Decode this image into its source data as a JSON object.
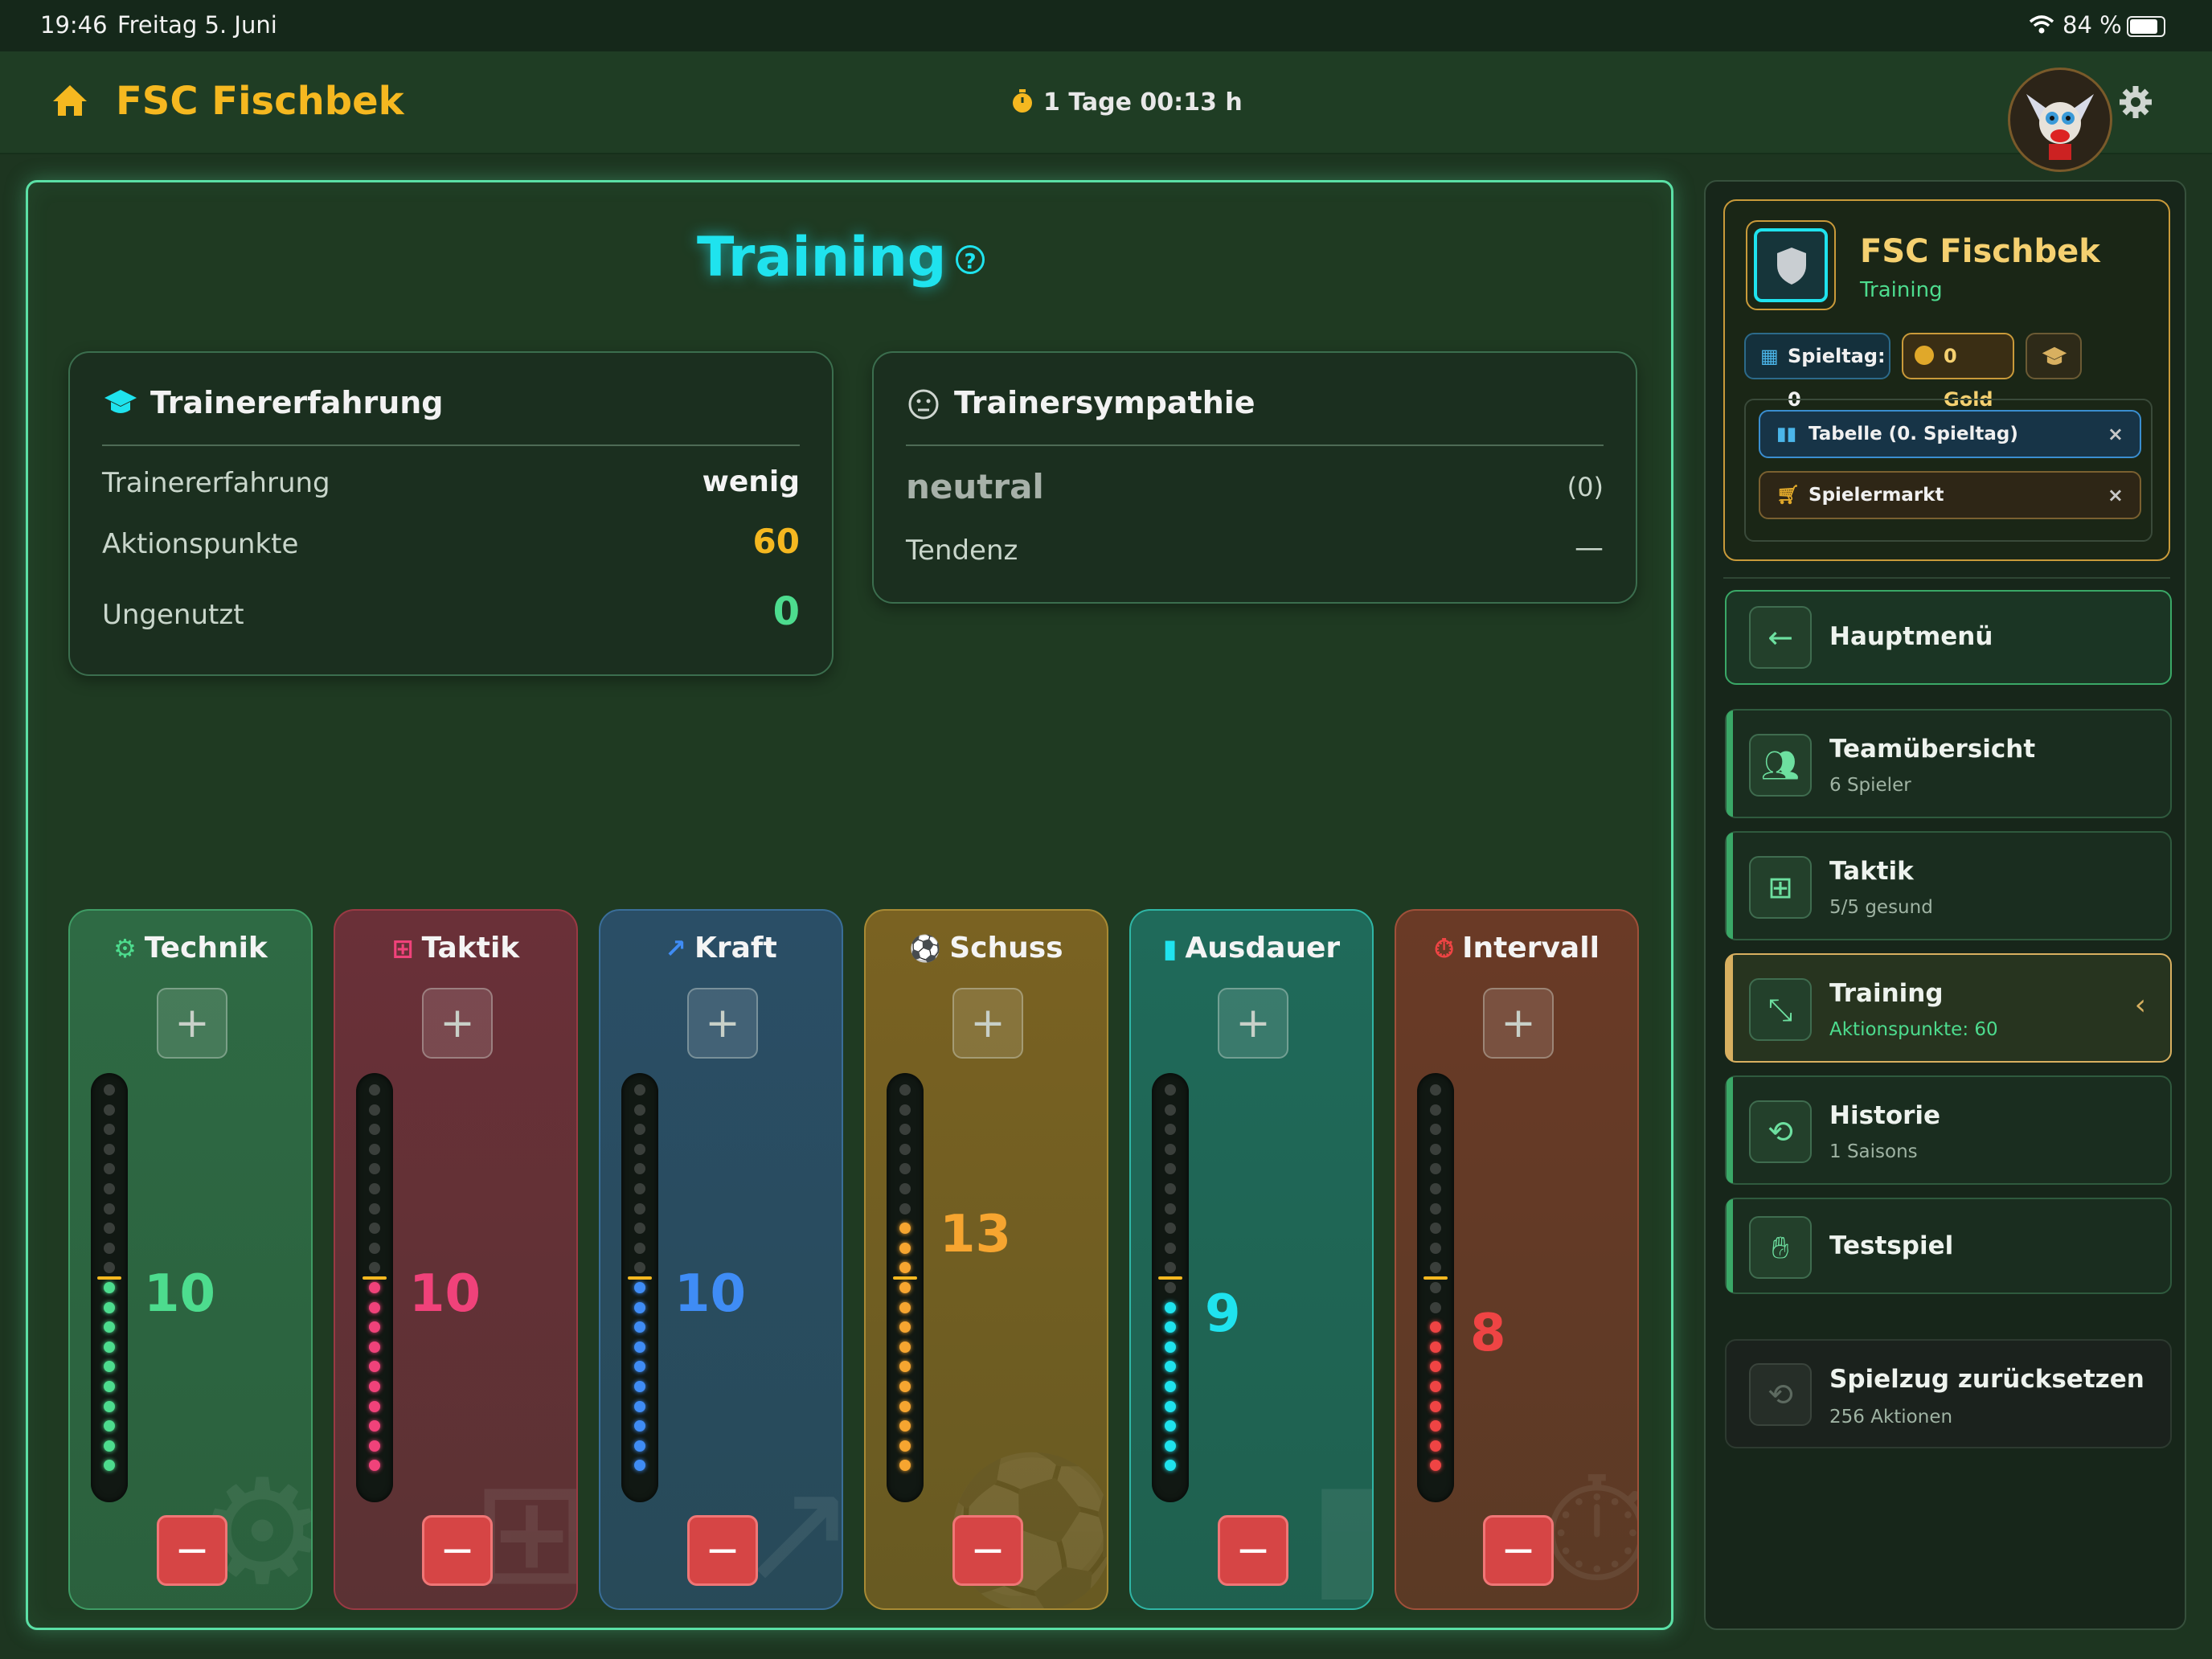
{
  "status_bar": {
    "time": "19:46",
    "date": "Freitag 5. Juni",
    "battery": "84 %"
  },
  "header": {
    "club_name": "FSC Fischbek",
    "timer": "1 Tage 00:13 h"
  },
  "page": {
    "title": "Training",
    "help_icon": "question-circle-icon"
  },
  "trainer_experience": {
    "heading": "Trainererfahrung",
    "rows": [
      {
        "label": "Trainererfahrung",
        "value": "wenig"
      },
      {
        "label": "Aktionspunkte",
        "value": "60"
      },
      {
        "label": "Ungenutzt",
        "value": "0"
      }
    ]
  },
  "trainer_sympathy": {
    "heading": "Trainersympathie",
    "mood": "neutral",
    "mood_value": "(0)",
    "trend_label": "Tendenz",
    "trend_value": "—"
  },
  "training_attributes": [
    {
      "name": "Technik",
      "value": "10",
      "level": 10,
      "color": "#4ddc8e",
      "icon": "lightbulb-gear-icon"
    },
    {
      "name": "Taktik",
      "value": "10",
      "level": 10,
      "color": "#f0427a",
      "icon": "tactics-icon"
    },
    {
      "name": "Kraft",
      "value": "10",
      "level": 10,
      "color": "#3f8cf5",
      "icon": "dumbbell-icon"
    },
    {
      "name": "Schuss",
      "value": "13",
      "level": 13,
      "color": "#f6a530",
      "icon": "football-icon"
    },
    {
      "name": "Ausdauer",
      "value": "9",
      "level": 9,
      "color": "#1fe3ee",
      "icon": "battery-icon"
    },
    {
      "name": "Intervall",
      "value": "8",
      "level": 8,
      "color": "#ef4444",
      "icon": "stopwatch-icon"
    }
  ],
  "controls": {
    "plus": "+",
    "minus": "−"
  },
  "sidebar": {
    "club_card": {
      "name": "FSC Fischbek",
      "subtitle": "Training",
      "matchday_chip": "Spieltag: 0",
      "gold_chip": "0 Gold",
      "tabs": [
        {
          "label": "Tabelle (0. Spieltag)",
          "close": "×"
        },
        {
          "label": "Spielermarkt",
          "close": "×"
        }
      ]
    },
    "back_item": {
      "label": "Hauptmenü"
    },
    "menu_items": [
      {
        "title": "Teamübersicht",
        "subtitle": "6 Spieler",
        "icon": "team-icon"
      },
      {
        "title": "Taktik",
        "subtitle": "5/5 gesund",
        "icon": "tactics-icon"
      },
      {
        "title": "Training",
        "subtitle": "Aktionspunkte: 60",
        "icon": "dumbbell-icon",
        "active": true
      },
      {
        "title": "Historie",
        "subtitle": "1 Saisons",
        "icon": "history-icon"
      },
      {
        "title": "Testspiel",
        "subtitle": "",
        "icon": "handshake-icon"
      }
    ],
    "reset_item": {
      "title": "Spielzug zurücksetzen",
      "subtitle": "256 Aktionen"
    }
  },
  "colors": {
    "accent": "#5be0a6",
    "gold": "#f5b820",
    "cyan": "#1fe3ee"
  }
}
